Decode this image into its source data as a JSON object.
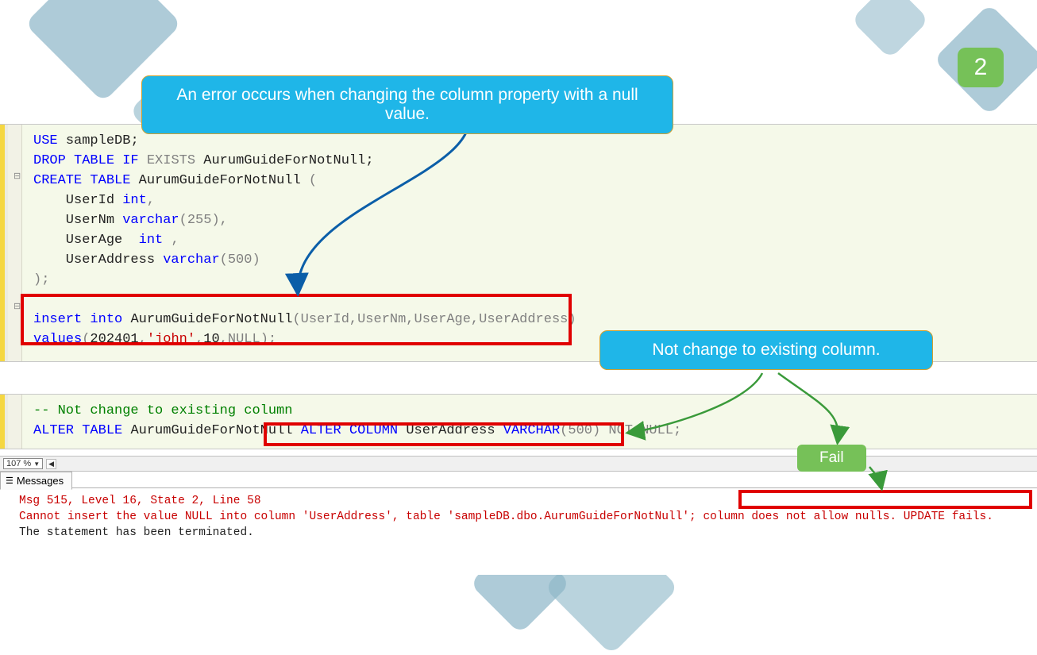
{
  "slide": {
    "number": "2"
  },
  "callouts": {
    "c1": "An error occurs when changing the column property with a null value.",
    "c2": "Not change to existing column.",
    "fail": "Fail"
  },
  "code_block_1": {
    "l1_use": "USE ",
    "l1_db": "sampleDB",
    "l2_drop": "DROP ",
    "l2_table": "TABLE ",
    "l2_if": "IF ",
    "l2_exists": "EXISTS ",
    "l2_name": "AurumGuideForNotNull",
    "l3_create": "CREATE ",
    "l3_table": "TABLE ",
    "l3_name": "AurumGuideForNotNull ",
    "l3_paren": "(",
    "l4": "    UserId ",
    "l4_type": "int",
    "l4_comma": ",",
    "l5": "    UserNm ",
    "l5_type": "varchar",
    "l5_args": "(255),",
    "l6": "    UserAge  ",
    "l6_type": "int ",
    "l6_comma": ",",
    "l7": "    UserAddress ",
    "l7_type": "varchar",
    "l7_args": "(500)",
    "l8": ");",
    "l10_insert": "insert ",
    "l10_into": "into ",
    "l10_name": "AurumGuideForNotNull",
    "l10_cols": "(UserId,UserNm,UserAge,UserAddress)",
    "l11_values_kw": "values",
    "l11_open": "(",
    "l11_v1": "202401",
    "l11_c1": ",",
    "l11_str": "'john'",
    "l11_c2": ",",
    "l11_v3": "10",
    "l11_c3": ",",
    "l11_null": "NULL",
    "l11_close": ");"
  },
  "code_block_2": {
    "comment": "-- Not change to existing column",
    "alter": "ALTER ",
    "table": "TABLE ",
    "name": "AurumGuideForNotNull ",
    "alter2": "ALTER ",
    "column": "COLUMN ",
    "col": "UserAddress ",
    "vtype": "VARCHAR",
    "vparen": "(500) ",
    "not": "NOT ",
    "null": "NULL",
    "semi": ";"
  },
  "zoom": {
    "value": "107 %"
  },
  "messages": {
    "tab_label": "Messages",
    "line1": "Msg 515, Level 16, State 2, Line 58",
    "line2a": "Cannot insert the value NULL into column 'UserAddress', table 'sampleDB.dbo.AurumGuideForNotNull'; ",
    "line2b": "column does not allow nulls. UPDATE fails.",
    "line3": "The statement has been terminated."
  }
}
